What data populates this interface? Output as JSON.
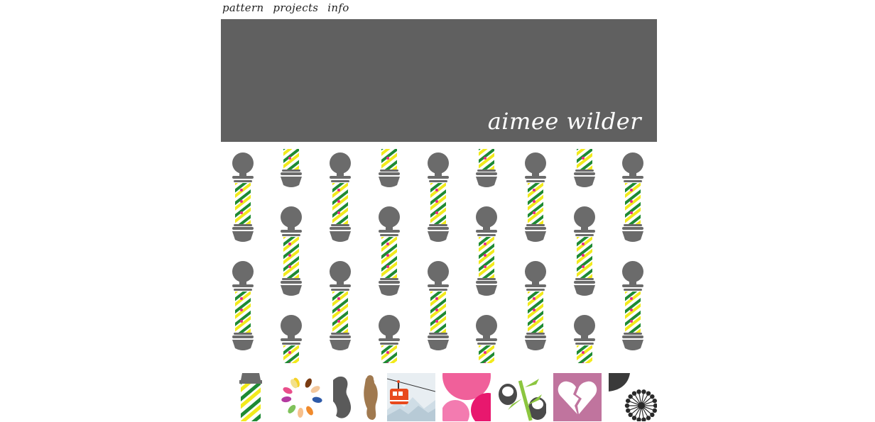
{
  "nav": {
    "items": [
      {
        "label": "pattern"
      },
      {
        "label": "projects"
      },
      {
        "label": "info"
      }
    ]
  },
  "banner": {
    "brand": "aimee wilder",
    "color": "#606060"
  },
  "pattern": {
    "motif": "barber-pole",
    "colors": {
      "cap": "#6b6b6b",
      "green": "#1e8a33",
      "yellow": "#f2ea1c",
      "heart": "#e8288a"
    }
  },
  "thumbnails": [
    {
      "icon": "barber-pole-thumb-icon"
    },
    {
      "icon": "petal-burst-thumb-icon"
    },
    {
      "icon": "figures-thumb-icon"
    },
    {
      "icon": "cable-car-thumb-icon"
    },
    {
      "icon": "pink-circles-thumb-icon"
    },
    {
      "icon": "panda-bamboo-thumb-icon"
    },
    {
      "icon": "broken-heart-thumb-icon"
    },
    {
      "icon": "dandelion-thumb-icon"
    }
  ]
}
